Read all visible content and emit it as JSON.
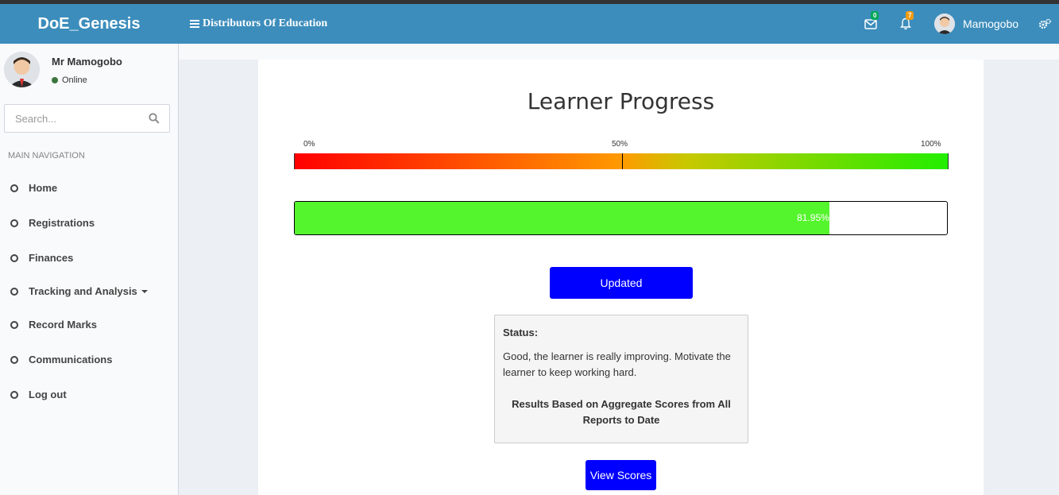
{
  "header": {
    "logo": "DoE_Genesis",
    "subtitle": "Distributors Of Education",
    "mail_count": "0",
    "notif_count": "7",
    "username": "Mamogobo",
    "mail_badge_color": "#00a65a",
    "notif_badge_color": "#f39c12"
  },
  "sidebar": {
    "user_name": "Mr Mamogobo",
    "user_status": "Online",
    "search_placeholder": "Search...",
    "nav_heading": "MAIN NAVIGATION",
    "items": [
      {
        "label": "Home"
      },
      {
        "label": "Registrations"
      },
      {
        "label": "Finances"
      },
      {
        "label": "Tracking and Analysis"
      },
      {
        "label": "Record Marks"
      },
      {
        "label": "Communications"
      },
      {
        "label": "Log out"
      }
    ]
  },
  "main": {
    "title": "Learner Progress",
    "scale": {
      "min": "0%",
      "mid": "50%",
      "max": "100%"
    },
    "progress_label": "81.95%",
    "progress_value": 81.95,
    "updated_button": "Updated",
    "status_label": "Status:",
    "status_message": "Good, the learner is really improving. Motivate the learner to keep working hard.",
    "status_note": "Results Based on Aggregate Scores from All Reports to Date",
    "view_scores_button": "View Scores"
  },
  "colors": {
    "header": "#3c8dbc",
    "button": "#0000ff",
    "progress_fill": "#55f52d"
  }
}
